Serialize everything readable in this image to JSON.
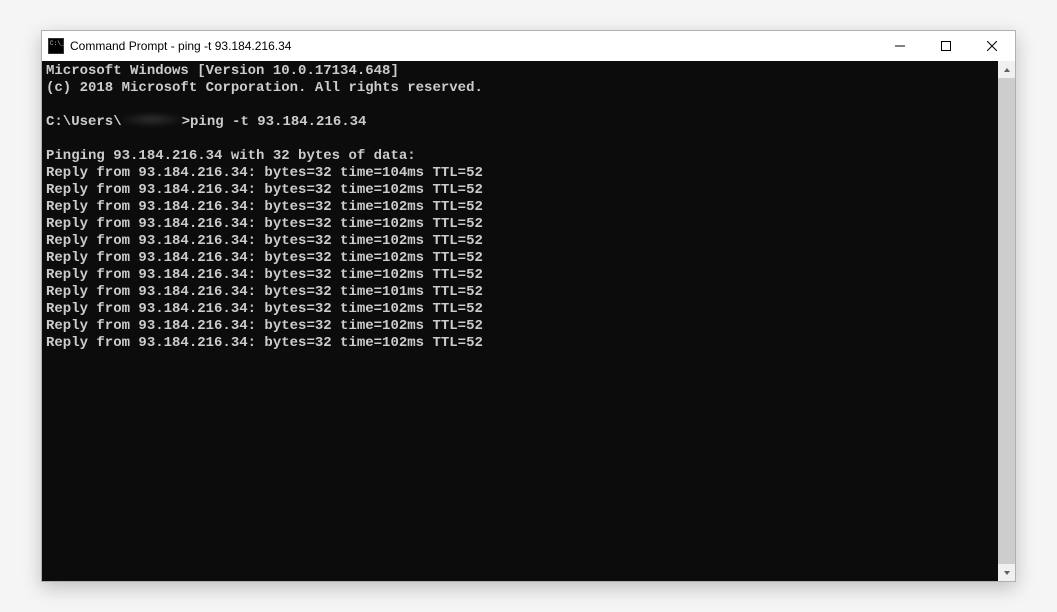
{
  "window": {
    "title": "Command Prompt - ping  -t 93.184.216.34"
  },
  "terminal": {
    "banner_line1": "Microsoft Windows [Version 10.0.17134.648]",
    "banner_line2": "(c) 2018 Microsoft Corporation. All rights reserved.",
    "prompt_prefix": "C:\\Users\\",
    "prompt_suffix": ">",
    "command": "ping -t 93.184.216.34",
    "ping_header": "Pinging 93.184.216.34 with 32 bytes of data:",
    "replies": [
      "Reply from 93.184.216.34: bytes=32 time=104ms TTL=52",
      "Reply from 93.184.216.34: bytes=32 time=102ms TTL=52",
      "Reply from 93.184.216.34: bytes=32 time=102ms TTL=52",
      "Reply from 93.184.216.34: bytes=32 time=102ms TTL=52",
      "Reply from 93.184.216.34: bytes=32 time=102ms TTL=52",
      "Reply from 93.184.216.34: bytes=32 time=102ms TTL=52",
      "Reply from 93.184.216.34: bytes=32 time=102ms TTL=52",
      "Reply from 93.184.216.34: bytes=32 time=101ms TTL=52",
      "Reply from 93.184.216.34: bytes=32 time=102ms TTL=52",
      "Reply from 93.184.216.34: bytes=32 time=102ms TTL=52",
      "Reply from 93.184.216.34: bytes=32 time=102ms TTL=52"
    ]
  }
}
